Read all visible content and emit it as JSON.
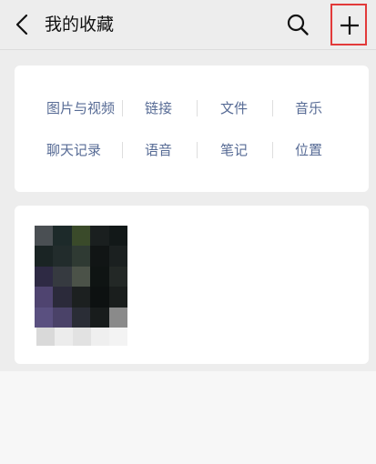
{
  "header": {
    "title": "我的收藏",
    "back_icon": "chevron-left-icon",
    "search_icon": "search-icon",
    "add_icon": "plus-icon",
    "highlight_color": "#e23a3a"
  },
  "categories": [
    {
      "label": "图片与视频"
    },
    {
      "label": "链接"
    },
    {
      "label": "文件"
    },
    {
      "label": "音乐"
    },
    {
      "label": "聊天记录"
    },
    {
      "label": "语音"
    },
    {
      "label": "笔记"
    },
    {
      "label": "位置"
    }
  ],
  "colors": {
    "category_link": "#576b95",
    "background": "#ededed",
    "card": "#ffffff"
  },
  "favorites": [
    {
      "kind": "image",
      "content": "pixelated thumbnail"
    }
  ]
}
